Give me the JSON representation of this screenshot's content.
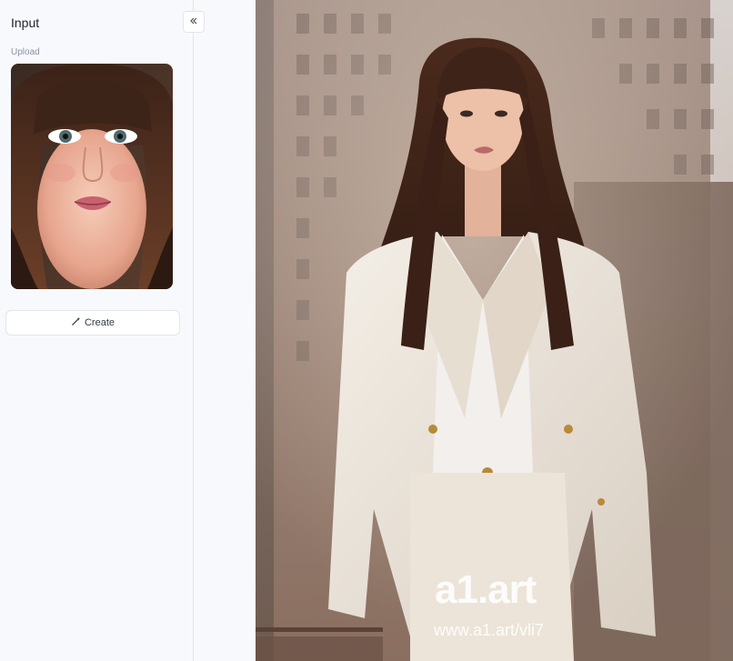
{
  "sidebar": {
    "title": "Input",
    "upload_label": "Upload",
    "create_label": "Create",
    "collapse_icon": "double-chevron-left-icon",
    "create_icon": "magic-wand-icon"
  },
  "result": {
    "watermark_brand": "a1.art",
    "watermark_url": "www.a1.art/vli7"
  },
  "colors": {
    "sidebar_bg": "#f8f9fc",
    "border": "#e4e6eb",
    "text": "#1f2328",
    "muted": "#8a93a3"
  }
}
